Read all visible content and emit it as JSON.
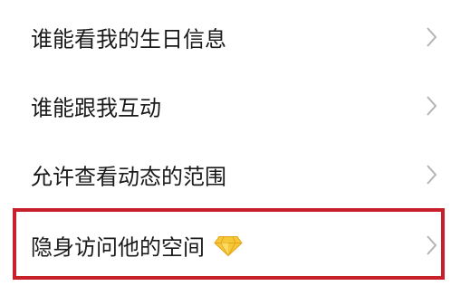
{
  "settings_list": {
    "items": [
      {
        "label": "谁能看我的生日信息",
        "icon": "chevron-right-icon"
      },
      {
        "label": "谁能跟我互动",
        "icon": "chevron-right-icon"
      },
      {
        "label": "允许查看动态的范围",
        "icon": "chevron-right-icon"
      },
      {
        "label": "隐身访问他的空间",
        "badge": "diamond-vip-icon",
        "icon": "chevron-right-icon"
      }
    ]
  },
  "colors": {
    "text": "#1a1a1a",
    "chevron": "#b4b4b4",
    "highlight_border": "#c8202a",
    "diamond_fill": "#f6c737",
    "background": "#ffffff"
  }
}
